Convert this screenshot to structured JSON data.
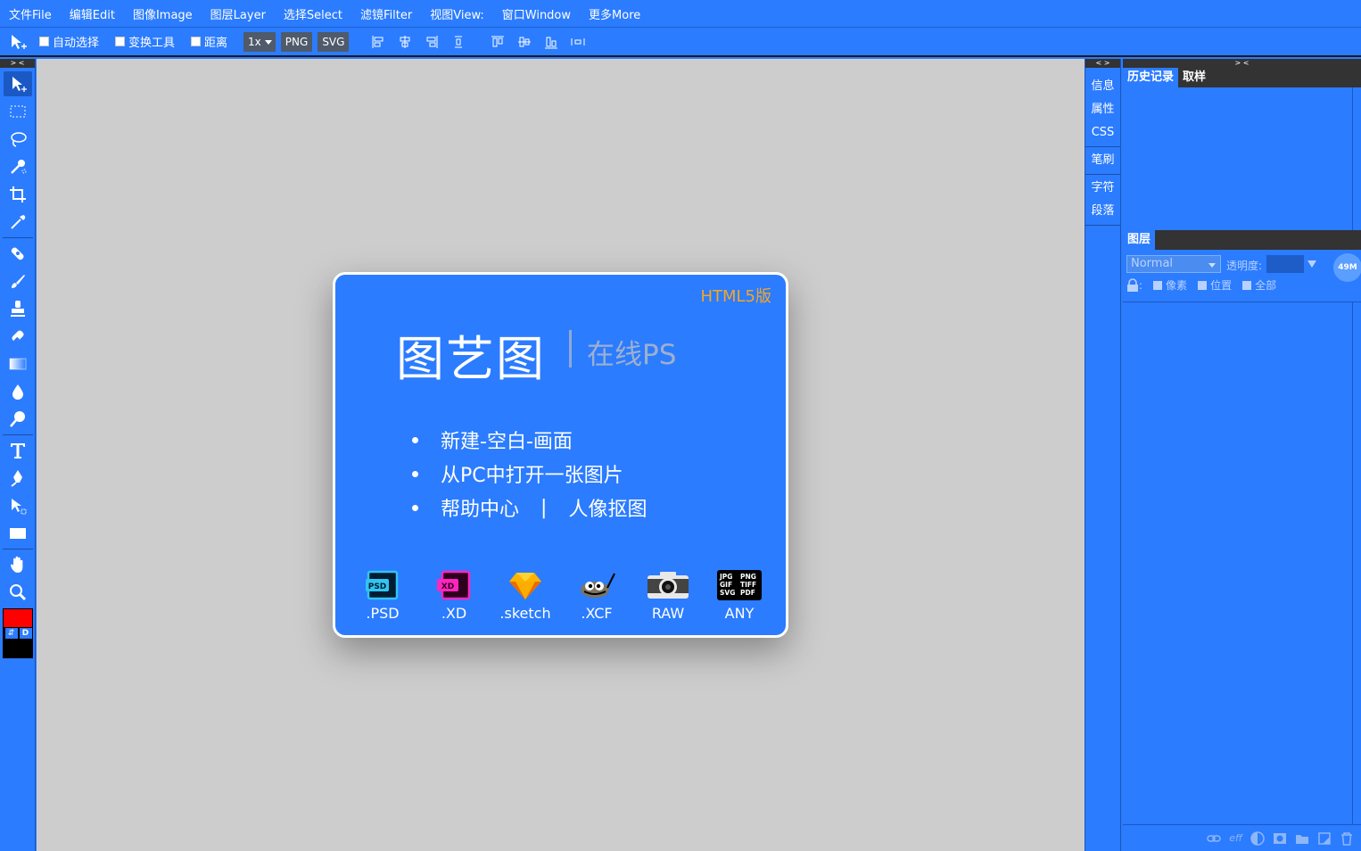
{
  "menubar": {
    "items": [
      "文件File",
      "编辑Edit",
      "图像Image",
      "图层Layer",
      "选择Select",
      "滤镜Filter",
      "视图View:",
      "窗口Window",
      "更多More"
    ]
  },
  "options": {
    "auto_select": "自动选择",
    "transform_tool": "变换工具",
    "distance": "距离",
    "zoom": "1x",
    "png": "PNG",
    "svg": "SVG"
  },
  "tools_header": "> <",
  "welcome": {
    "badge": "HTML5版",
    "brand": "图艺图",
    "subtitle": "在线PS",
    "links": {
      "new_blank": "新建-空白-画面",
      "open_from_pc": "从PC中打开一张图片",
      "help_center": "帮助中心",
      "divider": "|",
      "portrait_cutout": "人像抠图"
    },
    "formats": [
      ".PSD",
      ".XD",
      ".sketch",
      ".XCF",
      "RAW",
      "ANY"
    ],
    "format_icon_texts": {
      "psd": "PSD",
      "xd": "XD",
      "any": [
        "JPG",
        "PNG",
        "GIF",
        "TIFF",
        "SVG",
        "PDF"
      ]
    }
  },
  "sidetabs": {
    "header": "< >",
    "group1": [
      "信息",
      "属性",
      "CSS"
    ],
    "group2": [
      "笔刷"
    ],
    "group3": [
      "字符",
      "段落"
    ]
  },
  "panels": {
    "header": "> <",
    "history_tab": "历史记录",
    "swatches_tab": "取样",
    "layers_tab": "图层",
    "blend_mode": "Normal",
    "opacity_label": "透明度:",
    "memory": "49M",
    "lock_pixels": "像素",
    "lock_position": "位置",
    "lock_all": "全部",
    "lock_colon": ":",
    "footer_eff": "eff"
  },
  "colors": {
    "accent": "#2b7cff",
    "canvas": "#cdcdcd",
    "foreground_color": "#ff0000",
    "background_color": "#000000",
    "html5_badge": "#f5a623"
  }
}
